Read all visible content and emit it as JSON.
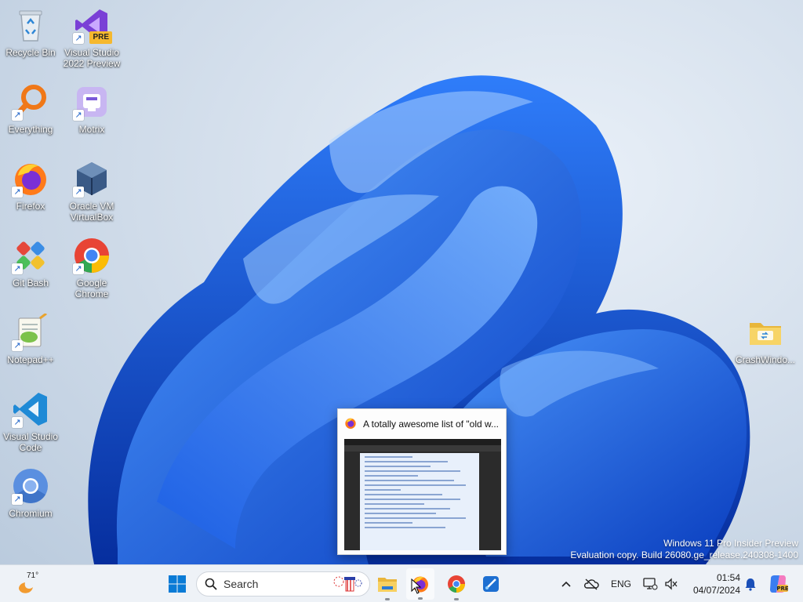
{
  "desktop": {
    "icons": [
      {
        "label": "Recycle Bin",
        "icon": "recycle-bin-icon"
      },
      {
        "label": "Visual Studio 2022 Preview",
        "icon": "visual-studio-icon",
        "badge": "PRE"
      },
      {
        "label": "Everything",
        "icon": "everything-search-icon"
      },
      {
        "label": "Motrix",
        "icon": "motrix-icon"
      },
      {
        "label": "Firefox",
        "icon": "firefox-icon"
      },
      {
        "label": "Oracle VM VirtualBox",
        "icon": "virtualbox-icon"
      },
      {
        "label": "Git Bash",
        "icon": "git-bash-icon"
      },
      {
        "label": "Google Chrome",
        "icon": "chrome-icon"
      },
      {
        "label": "Notepad++",
        "icon": "notepad-plus-plus-icon"
      },
      {
        "label": "Visual Studio Code",
        "icon": "vscode-icon"
      },
      {
        "label": "Chromium",
        "icon": "chromium-icon"
      },
      {
        "label": "CrashWindo...",
        "icon": "folder-icon"
      }
    ]
  },
  "watermark": {
    "line1": "Windows 11 Pro Insider Preview",
    "line2": "Evaluation copy. Build 26080.ge_release.240308-1400"
  },
  "preview": {
    "title": "A totally awesome list of \"old w..."
  },
  "taskbar": {
    "weather_temp": "71°",
    "search_placeholder": "Search",
    "language": "ENG",
    "time": "01:54",
    "date": "04/07/2024",
    "accent": "#0067c0"
  }
}
